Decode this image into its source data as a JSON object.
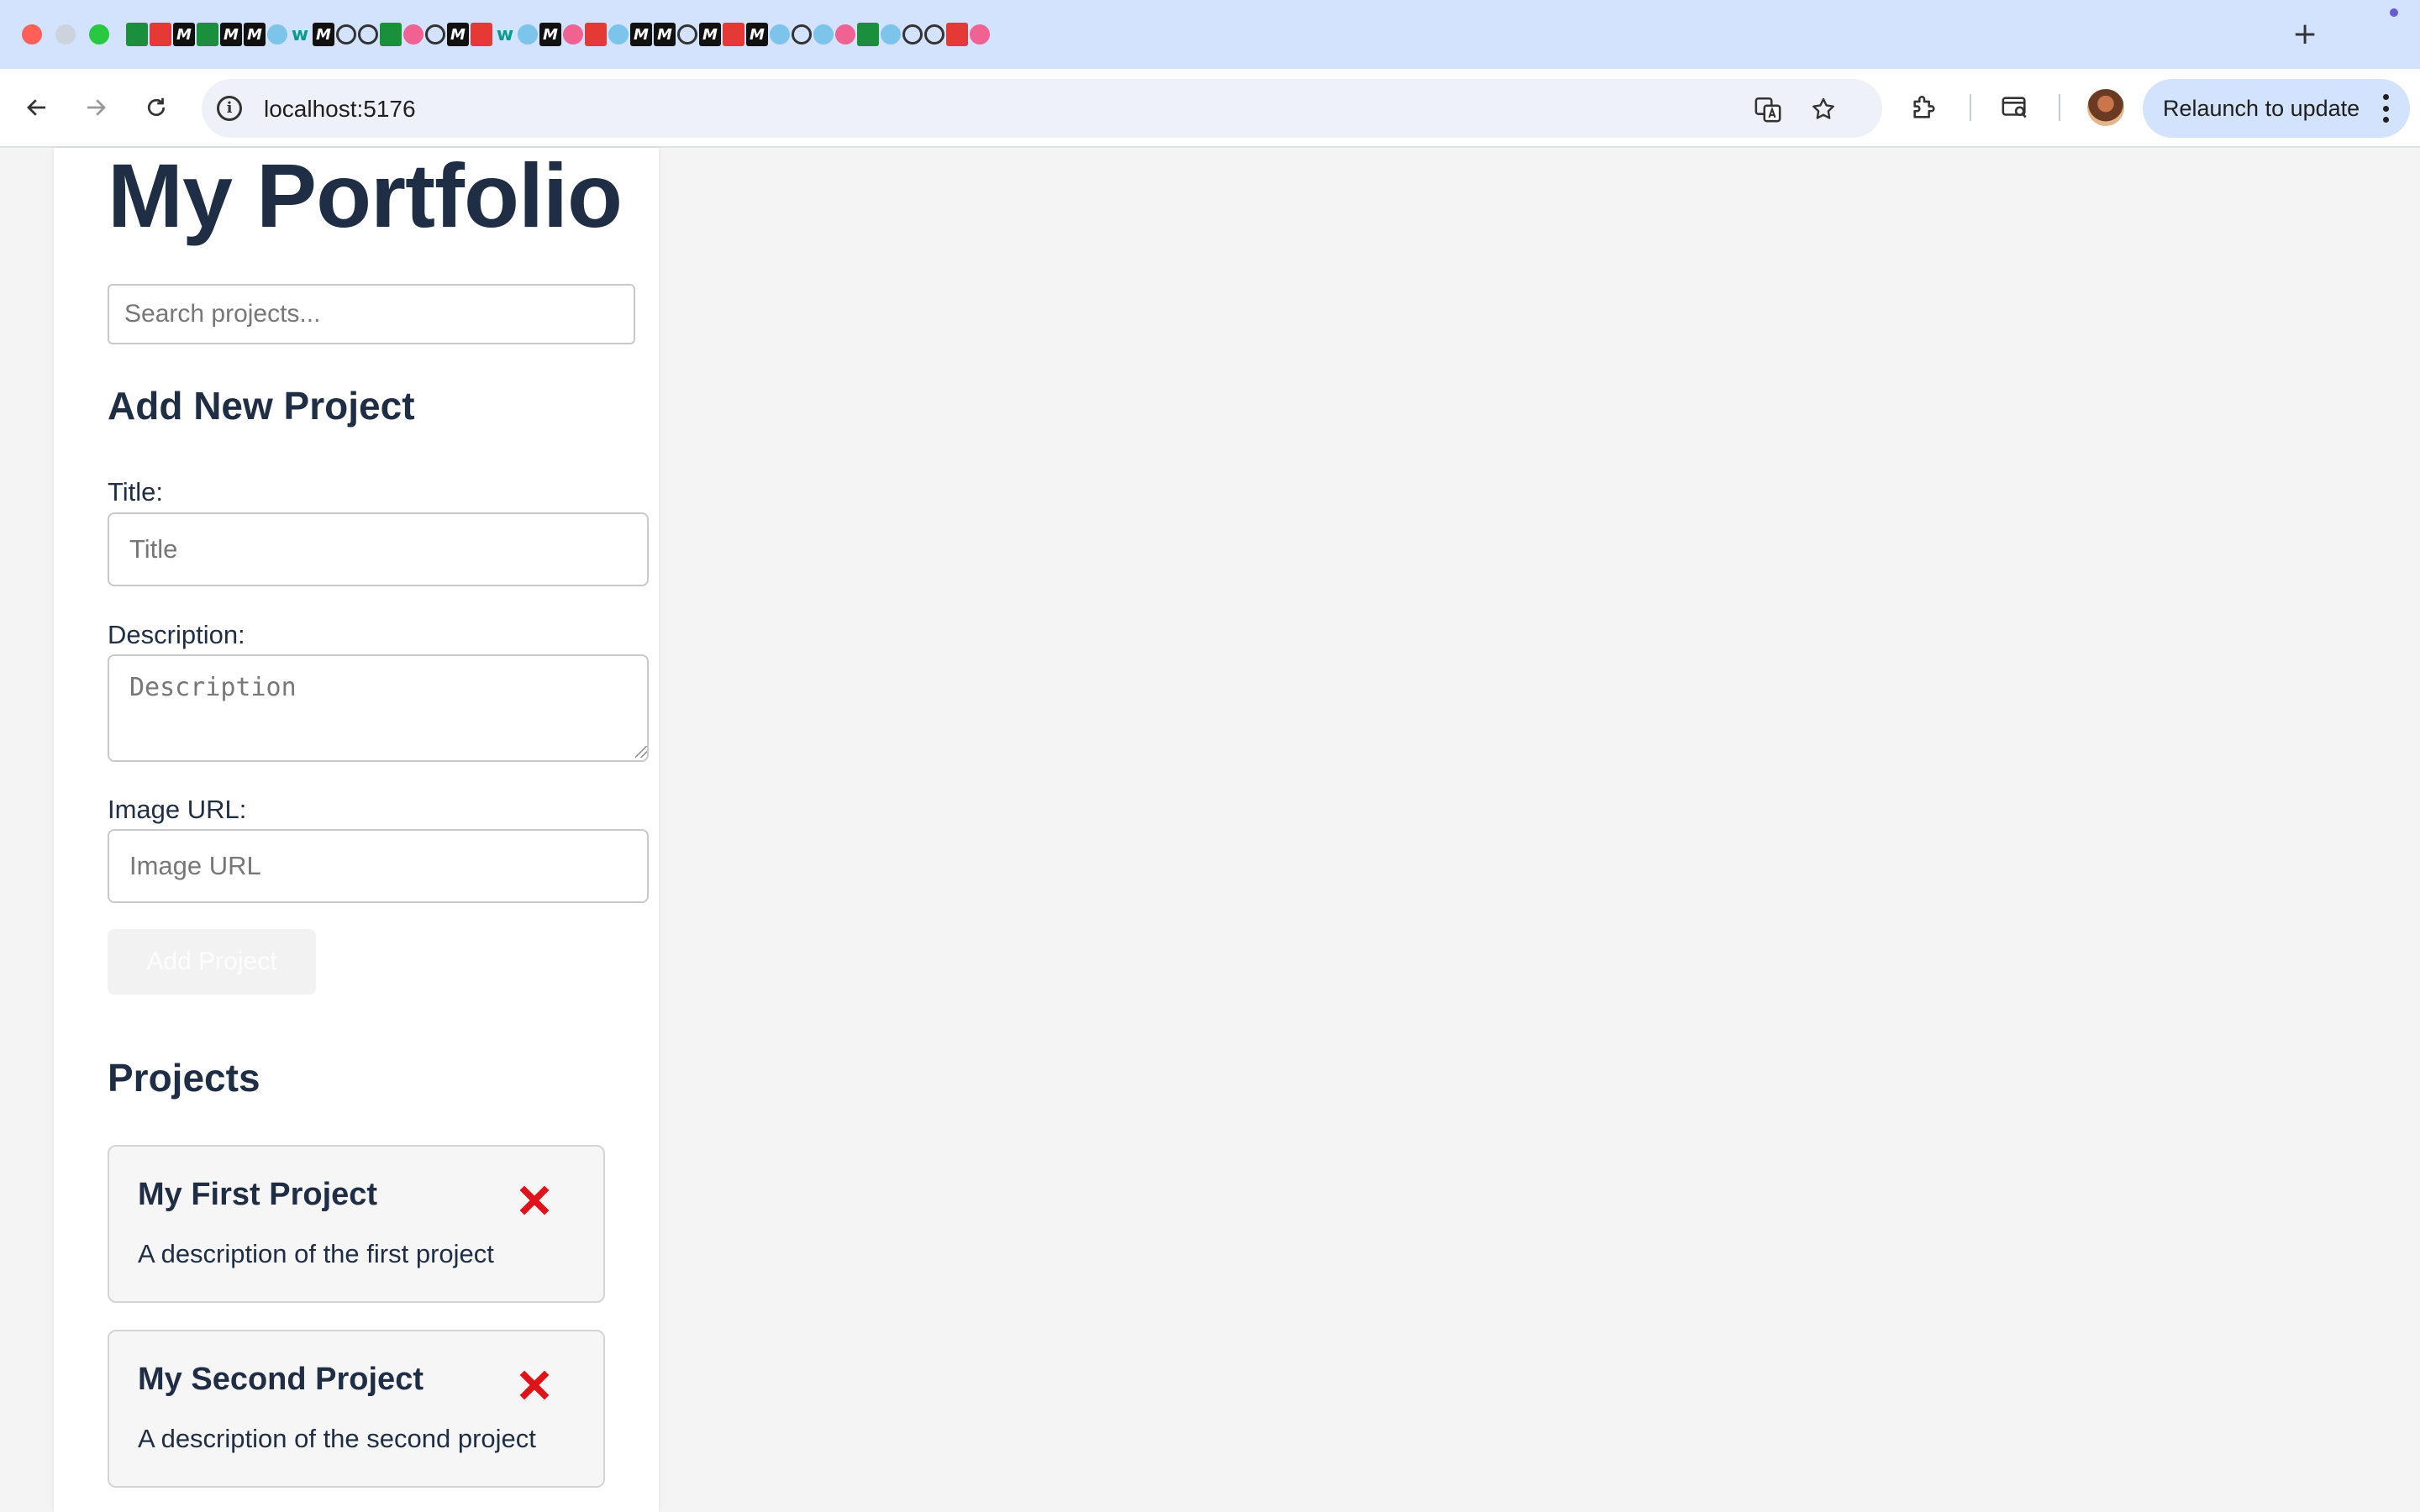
{
  "browser": {
    "url": "localhost:5176",
    "relaunch_label": "Relaunch to update",
    "tab_fav_labels": [
      "M",
      "M",
      "M",
      "M",
      "M",
      "M",
      "M",
      "M",
      "M",
      "M"
    ]
  },
  "page": {
    "title": "My Portfolio",
    "search_placeholder": "Search projects...",
    "form": {
      "heading": "Add New Project",
      "title_label": "Title:",
      "title_placeholder": "Title",
      "description_label": "Description:",
      "description_placeholder": "Description",
      "image_label": "Image URL:",
      "image_placeholder": "Image URL",
      "submit_label": "Add Project"
    },
    "projects_heading": "Projects",
    "projects": [
      {
        "title": "My First Project",
        "description": "A description of the first project"
      },
      {
        "title": "My Second Project",
        "description": "A description of the second project"
      }
    ]
  },
  "colors": {
    "heading": "#1f2e44",
    "delete": "#e0131a",
    "tabstrip": "#d3e3fd",
    "page_bg": "#f4f4f4"
  }
}
